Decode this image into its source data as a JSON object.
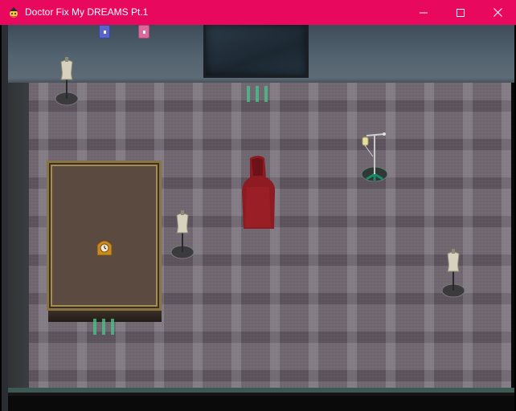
{
  "window": {
    "title": "Doctor Fix My DREAMS Pt.1",
    "titlebar_color": "#e8095f",
    "controls": {
      "minimize": "minimize-icon",
      "maximize": "maximize-icon",
      "close": "close-icon"
    }
  },
  "scene": {
    "back_wall_color": "#53636f",
    "floor_color": "#6f6670",
    "objects": [
      {
        "name": "dress-form-mannequin",
        "count": 3
      },
      {
        "name": "red-hooded-figure"
      },
      {
        "name": "iv-drip-stand"
      },
      {
        "name": "wooden-table"
      },
      {
        "name": "mantel-clock"
      },
      {
        "name": "dark-window"
      },
      {
        "name": "blue-wall-sign"
      },
      {
        "name": "pink-wall-sign"
      },
      {
        "name": "transfer-arrows",
        "count": 2
      }
    ]
  }
}
